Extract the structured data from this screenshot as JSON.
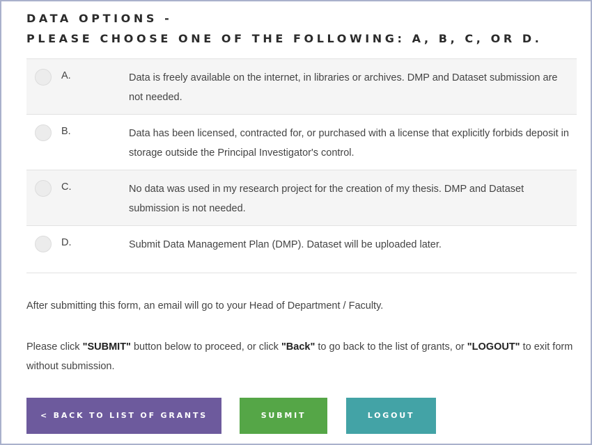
{
  "heading": {
    "line1": "DATA OPTIONS -",
    "line2": "PLEASE CHOOSE ONE OF THE FOLLOWING: A, B, C, OR D."
  },
  "options": [
    {
      "letter": "A.",
      "text": "Data is freely available on the internet, in libraries or archives. DMP and Dataset submission are not needed."
    },
    {
      "letter": "B.",
      "text": "Data has been licensed, contracted for, or purchased with a license that explicitly forbids deposit in storage outside the Principal Investigator's control."
    },
    {
      "letter": "C.",
      "text": "No data was used in my research project for the creation of my thesis. DMP and Dataset submission is not needed."
    },
    {
      "letter": "D.",
      "text": "Submit Data Management Plan (DMP). Dataset will be uploaded later."
    }
  ],
  "notice": "After submitting this form, an email will go to your Head of Department / Faculty.",
  "instructions": {
    "part1": "Please click ",
    "submit_word": "\"SUBMIT\"",
    "part2": " button below to proceed, or click ",
    "back_word": "\"Back\"",
    "part3": " to go back to the list of grants, or ",
    "logout_word": "\"LOGOUT\"",
    "part4": " to exit form without submission."
  },
  "buttons": {
    "back": "< BACK TO LIST OF GRANTS",
    "submit": "SUBMIT",
    "logout": "LOGOUT"
  },
  "colors": {
    "back": "#6d5a9d",
    "submit": "#55a647",
    "logout": "#43a3a6"
  }
}
